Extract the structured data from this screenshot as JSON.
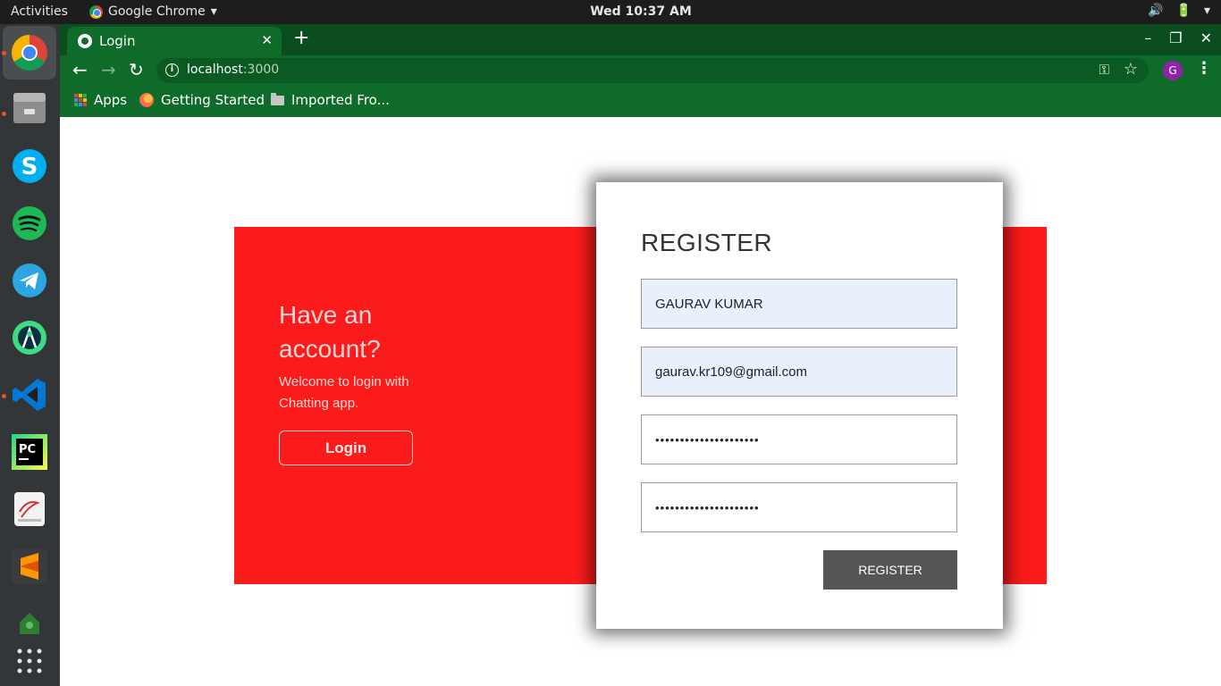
{
  "topbar": {
    "activities": "Activities",
    "app_name": "Google Chrome",
    "app_caret": "▾",
    "clock": "Wed 10:37 AM",
    "tray": {
      "volume": "🔊",
      "battery": "🔋",
      "caret": "▾"
    }
  },
  "dock": {
    "items": [
      "chrome",
      "files",
      "skype",
      "spotify",
      "telegram",
      "android-studio",
      "vscode",
      "pycharm",
      "document-viewer",
      "sublime-text",
      "lock",
      "show-applications"
    ]
  },
  "browser": {
    "tab": {
      "title": "Login",
      "close": "✕"
    },
    "new_tab": "+",
    "window_controls": {
      "minimize": "–",
      "maximize": "❐",
      "close": "✕"
    },
    "nav": {
      "back": "←",
      "forward": "→",
      "reload": "↻"
    },
    "url": {
      "host": "localhost",
      "port": ":3000"
    },
    "profile_initial": "G",
    "menu": "⋮",
    "bookmarks": [
      {
        "label": "Apps"
      },
      {
        "label": "Getting Started"
      },
      {
        "label": "Imported Fro..."
      }
    ]
  },
  "login_panel": {
    "heading": "Have an account?",
    "subtext": "Welcome to login with Chatting app.",
    "login_button": "Login"
  },
  "register_form": {
    "title": "REGISTER",
    "name_value": "GAURAV KUMAR",
    "email_value": "gaurav.kr109@gmail.com",
    "password_value": "•••••••••••••••••••••",
    "confirm_password_value": "•••••••••••••••••••••",
    "submit_label": "REGISTER"
  },
  "colors": {
    "panel_red": "#fc1b1b",
    "chrome_green": "#0f6b2a",
    "button_grey": "#555555",
    "autofill_blue": "#e8f0fe"
  }
}
